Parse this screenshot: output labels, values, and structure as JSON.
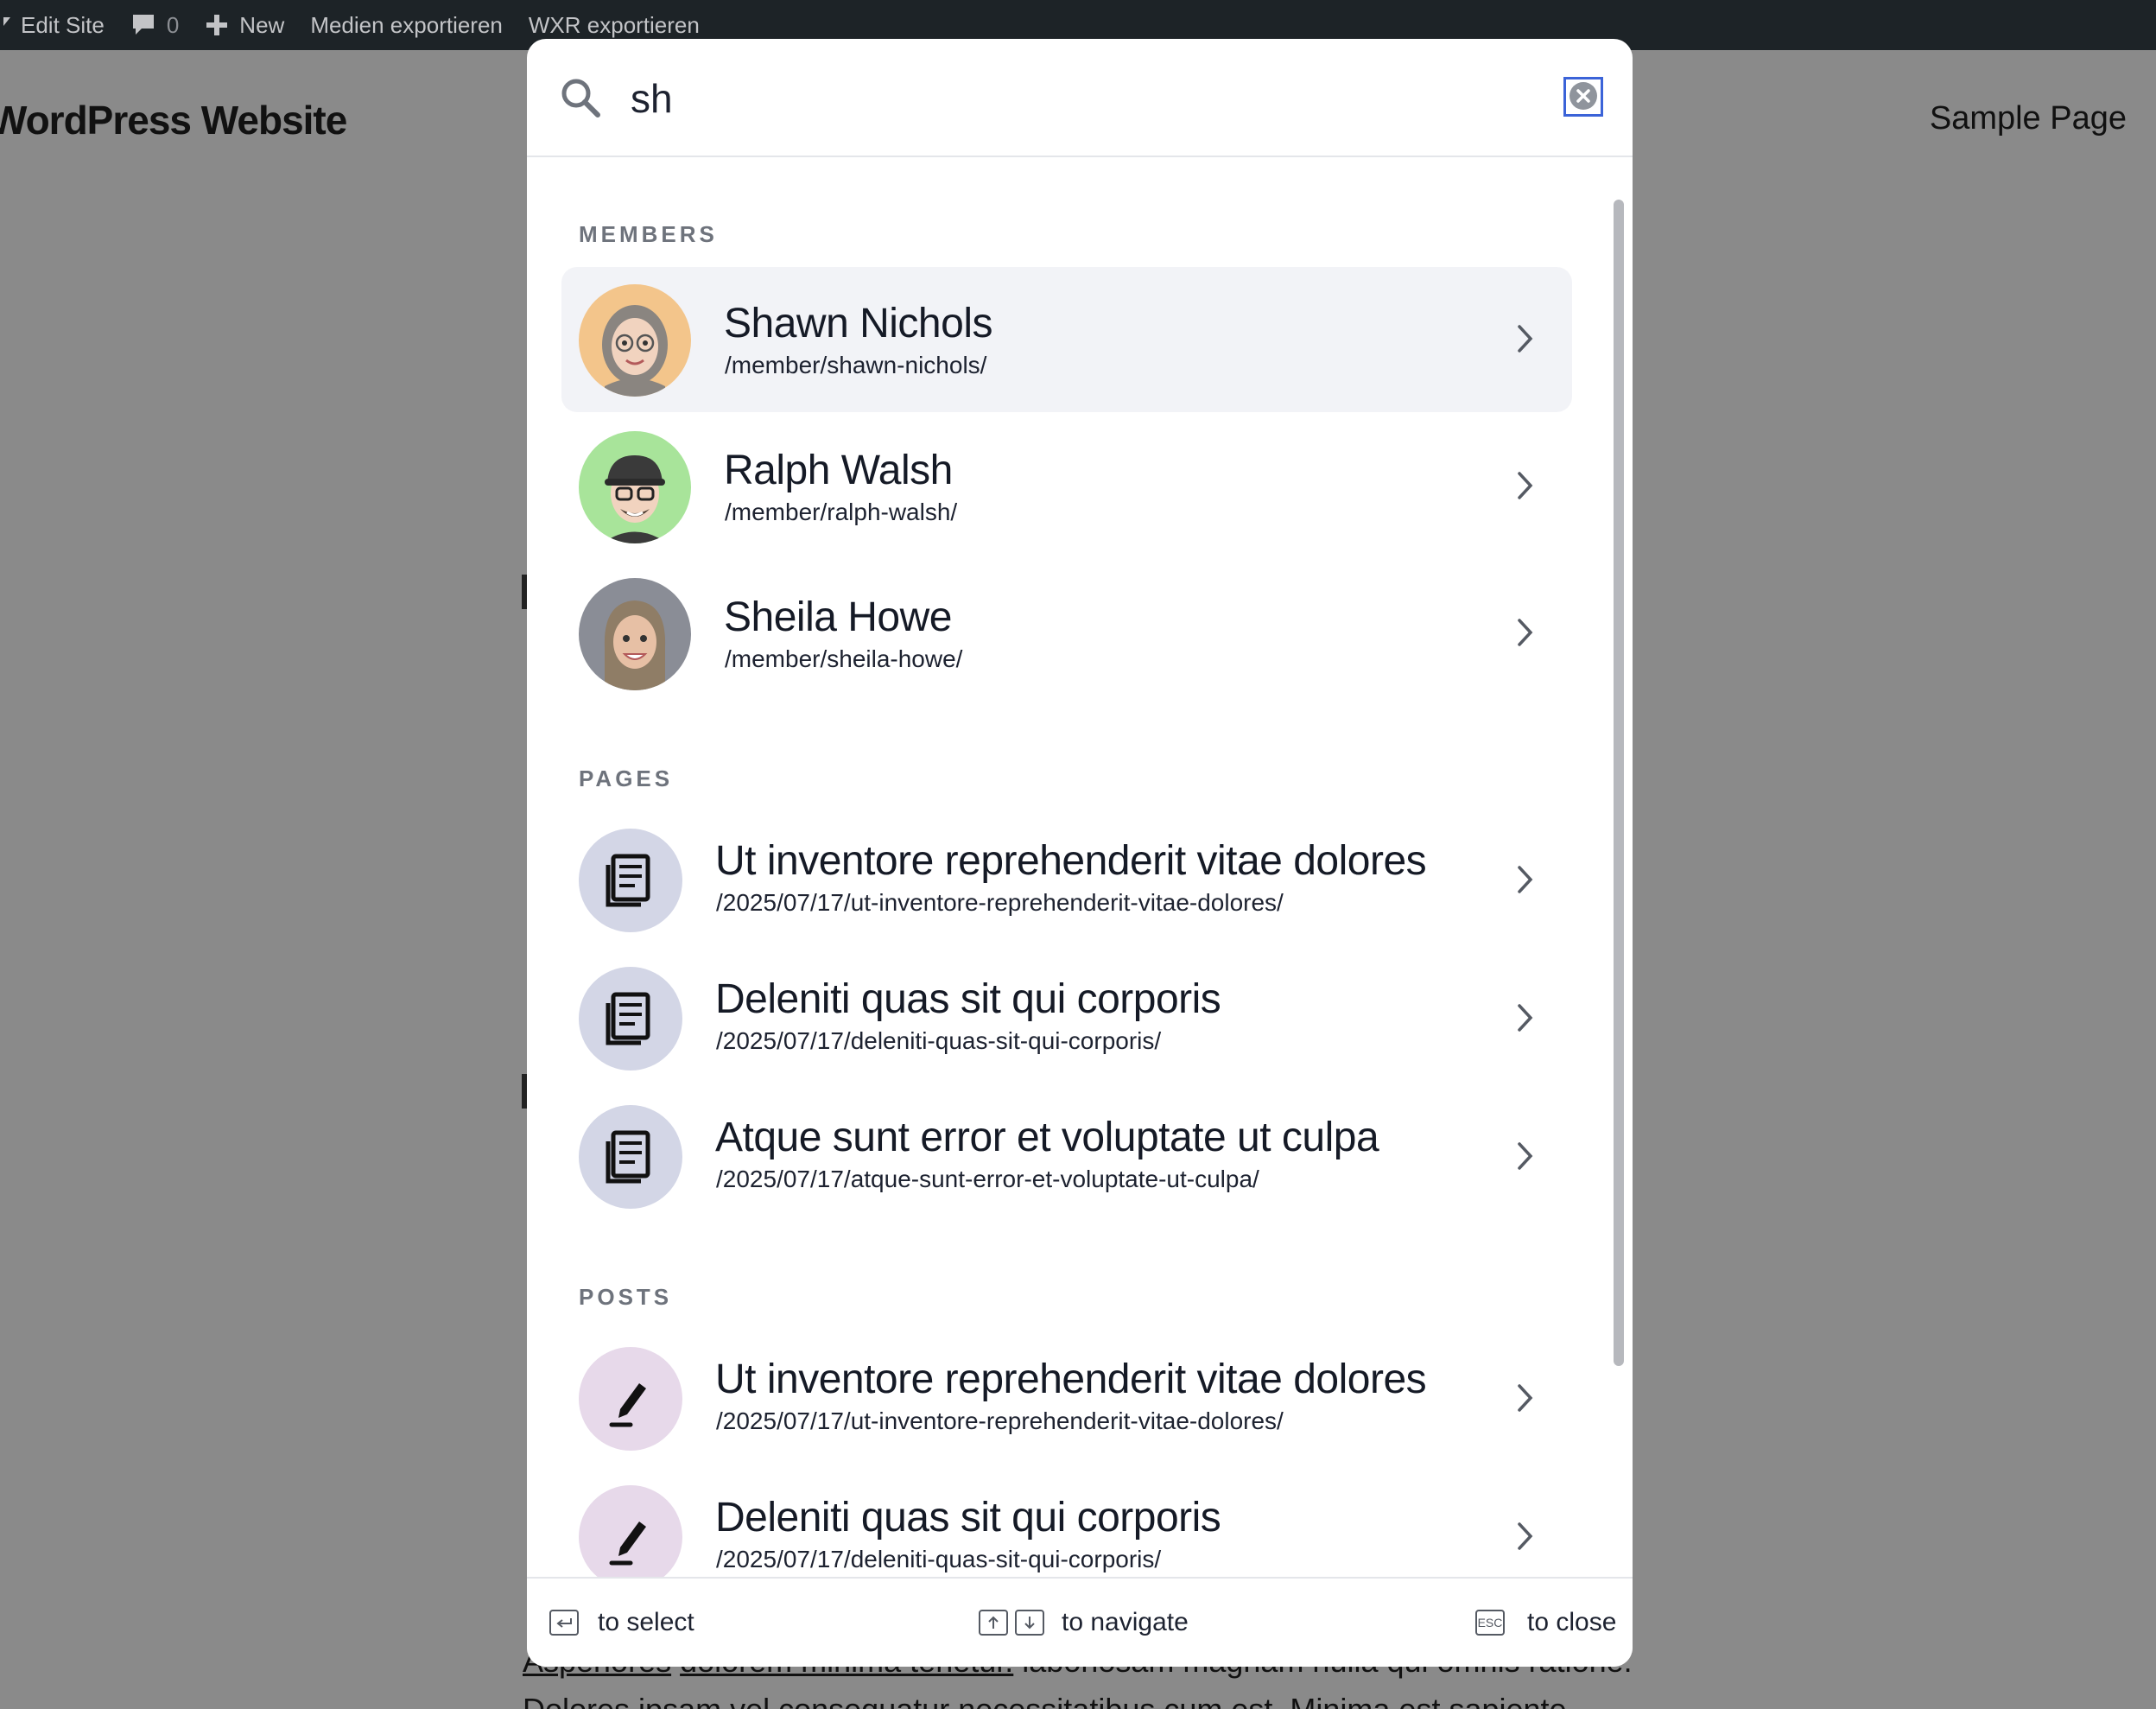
{
  "admin_bar": {
    "edit_site": "Edit Site",
    "comments_count": "0",
    "new": "New",
    "export_media": "Medien exportieren",
    "export_wxr": "WXR exportieren"
  },
  "site": {
    "title": "WordPress Website",
    "nav_item": "Sample Page",
    "bg_text_link1": "Asperiores",
    "bg_text_link2": "dolorem minima tenetur.",
    "bg_text_rest": " laboriosam magnam nulla qui omnis ratione.",
    "bg_text_line2": "Dolores ipsam vel consequatur necessitatibus cum est. Minima est sapiente"
  },
  "search": {
    "query": "sh",
    "clear_icon": "clear-x-icon"
  },
  "sections": {
    "members": {
      "title": "MEMBERS",
      "items": [
        {
          "name": "Shawn Nichols",
          "url": "/member/shawn-nichols/",
          "avatar_color": "#f3c58b"
        },
        {
          "name": "Ralph Walsh",
          "url": "/member/ralph-walsh/",
          "avatar_color": "#a8e49a"
        },
        {
          "name": "Sheila Howe",
          "url": "/member/sheila-howe/",
          "avatar_color": "#8a8d96"
        }
      ]
    },
    "pages": {
      "title": "PAGES",
      "items": [
        {
          "title": "Ut inventore reprehenderit vitae dolores",
          "url": "/2025/07/17/ut-inventore-reprehenderit-vitae-dolores/"
        },
        {
          "title": "Deleniti quas sit qui corporis",
          "url": "/2025/07/17/deleniti-quas-sit-qui-corporis/"
        },
        {
          "title": "Atque sunt error et voluptate ut culpa",
          "url": "/2025/07/17/atque-sunt-error-et-voluptate-ut-culpa/"
        }
      ]
    },
    "posts": {
      "title": "POSTS",
      "items": [
        {
          "title": "Ut inventore reprehenderit vitae dolores",
          "url": "/2025/07/17/ut-inventore-reprehenderit-vitae-dolores/"
        },
        {
          "title": "Deleniti quas sit qui corporis",
          "url": "/2025/07/17/deleniti-quas-sit-qui-corporis/"
        }
      ]
    }
  },
  "footer": {
    "select": "to select",
    "navigate": "to navigate",
    "close": "to close",
    "esc_key": "ESC"
  },
  "colors": {
    "page_icon_bg": "#d3d6e6",
    "post_icon_bg": "#e7d9ea",
    "active_row_bg": "#f2f3f7",
    "focus_ring": "#3b63d8"
  }
}
